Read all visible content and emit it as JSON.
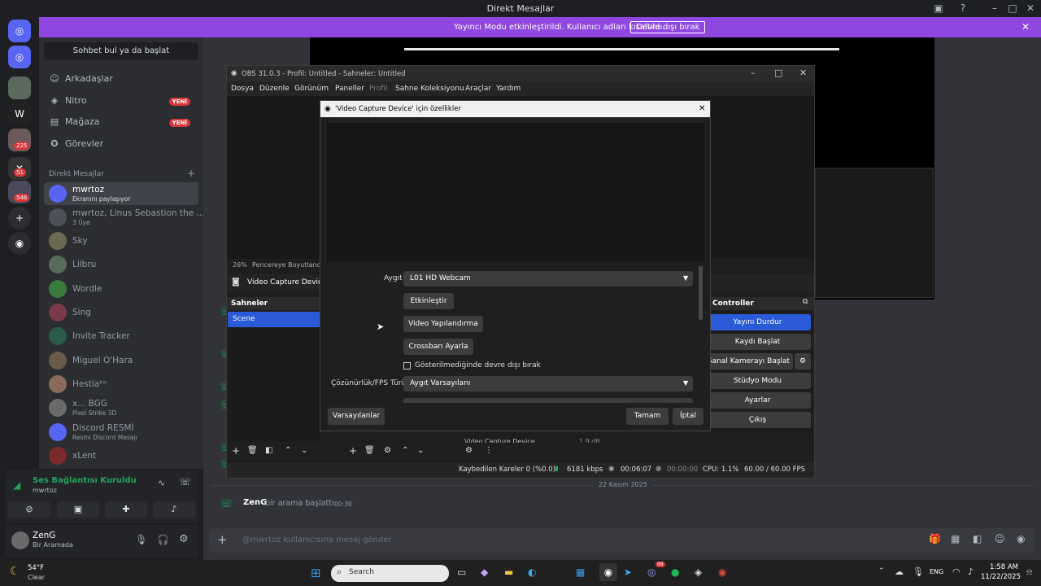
{
  "window": {
    "title": "Direkt Mesajlar"
  },
  "banner": {
    "message": "Yayıncı Modu etkinleştirildi. Kullanıcı adları kısaltıldı.",
    "button": "Devre dışı bırak"
  },
  "guild_badges": [
    "225",
    "51",
    "546"
  ],
  "sidebar": {
    "search": "Sohbet bul ya da başlat",
    "nav": [
      {
        "label": "Arkadaşlar",
        "icon": "friends-icon"
      },
      {
        "label": "Nitro",
        "badge": "YENİ",
        "icon": "nitro-icon"
      },
      {
        "label": "Mağaza",
        "badge": "YENİ",
        "icon": "shop-icon"
      },
      {
        "label": "Görevler",
        "icon": "quests-icon"
      }
    ],
    "dm_header": "Direkt Mesajlar",
    "dms": [
      {
        "name": "mwrtoz",
        "sub": "Ekranını paylaşıyor"
      },
      {
        "name": "mwrtoz, Linus Sebastion the ...",
        "sub": "3 Üye"
      },
      {
        "name": "Sky",
        "sub": ""
      },
      {
        "name": "Lilbru",
        "sub": ""
      },
      {
        "name": "Wordle",
        "sub": ""
      },
      {
        "name": "Sing",
        "sub": ""
      },
      {
        "name": "Invite Tracker",
        "sub": ""
      },
      {
        "name": "Miguel O'Hara",
        "sub": ""
      },
      {
        "name": "Hestiaᵏᵒ",
        "sub": ""
      },
      {
        "name": "x... BGG",
        "sub": "Pixel Strike 3D"
      },
      {
        "name": "Discord RESMİ",
        "sub": "Resmi Discord Mesajı"
      },
      {
        "name": "xLent",
        "sub": ""
      }
    ]
  },
  "voice": {
    "status": "Ses Bağlantısı Kuruldu",
    "channel": "mwrtoz"
  },
  "user": {
    "name": "ZenG",
    "status": "Bir Aramada"
  },
  "chat": {
    "date": "22 Kasım 2025",
    "call_user": "ZenG",
    "call_text": "bir arama başlattı.",
    "call_time": "00:30",
    "placeholder": "@mwrtoz kullanıcısına mesaj gönder"
  },
  "obs": {
    "title": "OBS 31.0.3 - Profil: Untitled - Sahneler: Untitled",
    "menu": [
      "Dosya",
      "Düzenle",
      "Görünüm",
      "Paneller",
      "Profil",
      "Sahne Koleksiyonu",
      "Araçlar",
      "Yardım"
    ],
    "zoom": "26%",
    "zoom_label": "Pencereye Boyutlandır",
    "source_bar": "Video Capture Device",
    "scenes_header": "Sahneler",
    "scene": "Scene",
    "controls_header": "Controller",
    "controls": [
      "Yayını Durdur",
      "Kaydı Başlat",
      "Sanal Kamerayı Başlat",
      "Stüdyo Modu",
      "Ayarlar",
      "Çıkış"
    ],
    "mixer_item": "Video Capture Device",
    "mixer_db": "1.9 dB",
    "status": {
      "dropped": "Kaybedilen Kareler 0 (%0.0)",
      "bitrate": "6181 kbps",
      "stream_time": "00:06:07",
      "rec_time": "00:00:00",
      "cpu": "CPU: 1.1%",
      "fps": "60.00 / 60.00 FPS"
    }
  },
  "dialog": {
    "title": "'Video Capture Device' için özellikler",
    "device_label": "Aygıt",
    "device_value": "L01 HD Webcam",
    "btn_activate": "Etkinleştir",
    "btn_config": "Video Yapılandırma",
    "btn_crossbar": "Crossbarı Ayarla",
    "checkbox": "Gösterilmediğinde devre dışı bırak",
    "res_label": "Çözünürlük/FPS Türü",
    "res_value": "Aygıt Varsayılanı",
    "btn_defaults": "Varsayılanlar",
    "btn_ok": "Tamam",
    "btn_cancel": "İptal"
  },
  "taskbar": {
    "weather_temp": "54°F",
    "weather_desc": "Clear",
    "search": "Search",
    "lang": "ENG",
    "time": "1:58 AM",
    "date": "11/22/2025",
    "discord_badge": "99"
  }
}
